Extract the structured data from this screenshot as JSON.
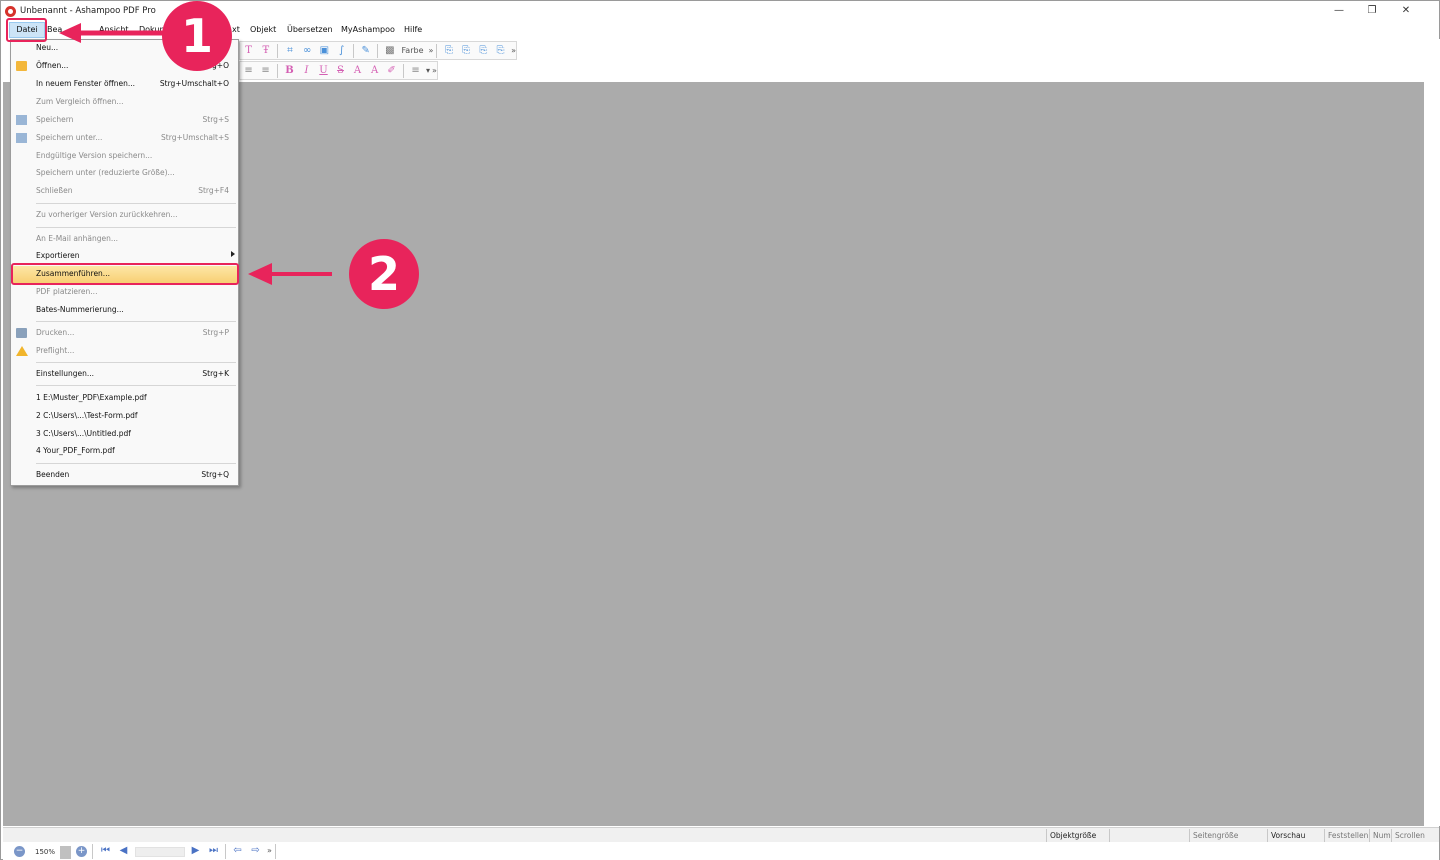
{
  "window": {
    "title": "Unbenannt - Ashampoo PDF Pro",
    "minimize_glyph": "—",
    "restore_glyph": "❐",
    "close_glyph": "✕"
  },
  "menubar": {
    "items": [
      "Datei",
      "Bearbeiten",
      "Ansicht",
      "Dokument",
      "Text",
      "Objekt",
      "Übersetzen",
      "MyAshampoo",
      "Hilfe"
    ],
    "visible": {
      "datei": "Datei",
      "bearbeiten": "Bea",
      "ansicht": "Ansicht",
      "dokument": "Dokum",
      "text": "xt",
      "objekt": "Objekt",
      "uebersetzen": "Übersetzen",
      "myashampoo": "MyAshampoo",
      "hilfe": "Hilfe"
    }
  },
  "toolbar": {
    "farbe_label": "Farbe",
    "more": "»",
    "bold": "B",
    "italic": "I",
    "underline": "U",
    "strike": "S",
    "superscript": "A",
    "subscript": "A",
    "align": "≡",
    "list": "≡",
    "dropdown": "▾"
  },
  "file_menu": {
    "items": [
      {
        "label": "Neu...",
        "shortcut": "",
        "disabled": false
      },
      {
        "label": "Öffnen...",
        "shortcut": "Strg+O",
        "disabled": false
      },
      {
        "label": "In neuem Fenster öffnen...",
        "shortcut": "Strg+Umschalt+O",
        "disabled": false
      },
      {
        "label": "Zum Vergleich öffnen...",
        "shortcut": "",
        "disabled": true
      },
      {
        "label": "Speichern",
        "shortcut": "Strg+S",
        "disabled": true
      },
      {
        "label": "Speichern unter...",
        "shortcut": "Strg+Umschalt+S",
        "disabled": true
      },
      {
        "label": "Endgültige Version speichern...",
        "shortcut": "",
        "disabled": true
      },
      {
        "label": "Speichern unter (reduzierte Größe)...",
        "shortcut": "",
        "disabled": true
      },
      {
        "label": "Schließen",
        "shortcut": "Strg+F4",
        "disabled": true
      },
      {
        "label": "Zu vorheriger Version zurückkehren...",
        "shortcut": "",
        "disabled": true
      },
      {
        "label": "An E-Mail anhängen...",
        "shortcut": "",
        "disabled": true
      },
      {
        "label": "Exportieren",
        "shortcut": "",
        "disabled": false
      },
      {
        "label": "Zusammenführen...",
        "shortcut": "",
        "disabled": false
      },
      {
        "label": "PDF platzieren...",
        "shortcut": "",
        "disabled": true
      },
      {
        "label": "Bates-Nummerierung...",
        "shortcut": "",
        "disabled": false
      },
      {
        "label": "Drucken...",
        "shortcut": "Strg+P",
        "disabled": true
      },
      {
        "label": "Preflight...",
        "shortcut": "",
        "disabled": true
      },
      {
        "label": "Einstellungen...",
        "shortcut": "Strg+K",
        "disabled": false
      },
      {
        "label": "1 E:\\Muster_PDF\\Example.pdf",
        "shortcut": "",
        "disabled": false
      },
      {
        "label": "2 C:\\Users\\...\\Test-Form.pdf",
        "shortcut": "",
        "disabled": false
      },
      {
        "label": "3 C:\\Users\\...\\Untitled.pdf",
        "shortcut": "",
        "disabled": false
      },
      {
        "label": "4 Your_PDF_Form.pdf",
        "shortcut": "",
        "disabled": false
      },
      {
        "label": "Beenden",
        "shortcut": "Strg+Q",
        "disabled": false
      }
    ],
    "open_shortcut_visible": "g+O"
  },
  "annotations": {
    "step1": "1",
    "step2": "2",
    "accent_color": "#e8245b"
  },
  "statusbar": {
    "objektgroesse": "Objektgröße",
    "seitengroesse": "Seitengröße",
    "vorschau": "Vorschau",
    "feststellen": "Feststellen",
    "num": "Num",
    "scrollen": "Scrollen"
  },
  "navbar": {
    "zoom": "150%",
    "more": "»"
  }
}
